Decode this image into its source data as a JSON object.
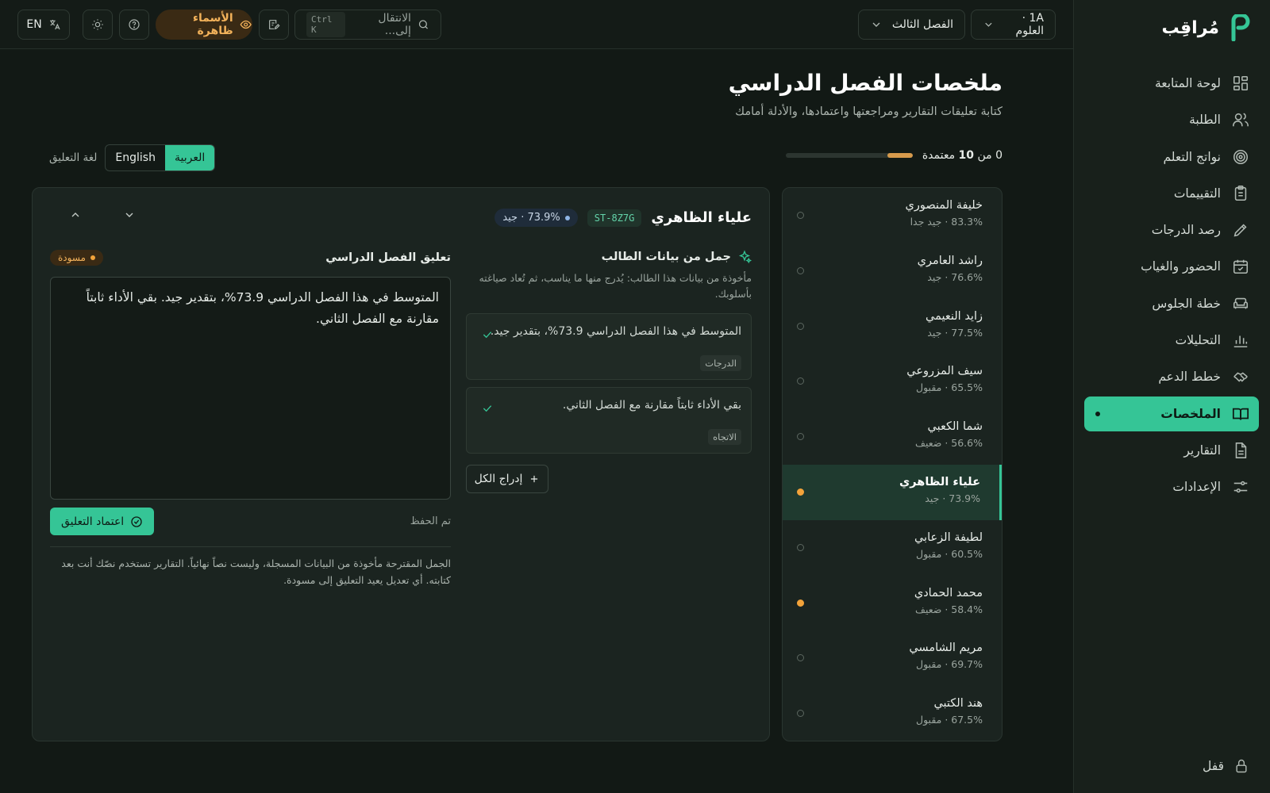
{
  "app": {
    "name": "مُراقِب"
  },
  "sidebar": {
    "items": [
      {
        "label": "لوحة المتابعة",
        "icon": "dashboard-icon"
      },
      {
        "label": "الطلبة",
        "icon": "users-icon"
      },
      {
        "label": "نواتج التعلم",
        "icon": "target-icon"
      },
      {
        "label": "التقييمات",
        "icon": "clipboard-icon"
      },
      {
        "label": "رصد الدرجات",
        "icon": "pencil-icon"
      },
      {
        "label": "الحضور والغياب",
        "icon": "calendar-check-icon"
      },
      {
        "label": "خطة الجلوس",
        "icon": "sofa-icon"
      },
      {
        "label": "التحليلات",
        "icon": "bar-chart-icon"
      },
      {
        "label": "خطط الدعم",
        "icon": "handshake-icon"
      },
      {
        "label": "الملخصات",
        "icon": "book-open-icon"
      },
      {
        "label": "التقارير",
        "icon": "file-text-icon"
      },
      {
        "label": "الإعدادات",
        "icon": "sliders-icon"
      }
    ],
    "active_index": 9,
    "lock_label": "قفل"
  },
  "topbar": {
    "class_select": "1A · العلوم",
    "term_select": "الفصل الثالث",
    "search_placeholder": "الانتقال إلى...",
    "search_shortcut": "Ctrl K",
    "names_toggle": "الأسماء ظاهرة",
    "lang_button": "EN"
  },
  "header": {
    "title": "ملخصات الفصل الدراسي",
    "subtitle": "كتابة تعليقات التقارير ومراجعتها واعتمادها، والأدلة أمامك",
    "progress": {
      "approved": 0,
      "total": 10,
      "text_a": "0 من ",
      "text_b": "10",
      "text_c": " معتمدة",
      "fill_fraction": 0.2
    }
  },
  "comment_language": {
    "label": "لغة التعليق",
    "options": [
      "العربية",
      "English"
    ],
    "selected": "العربية"
  },
  "students": [
    {
      "name": "خليفة المنصوري",
      "meta": "83.3% · جيد جدا",
      "status": "none"
    },
    {
      "name": "راشد العامري",
      "meta": "76.6% · جيد",
      "status": "none"
    },
    {
      "name": "زايد النعيمي",
      "meta": "77.5% · جيد",
      "status": "none"
    },
    {
      "name": "سيف المزروعي",
      "meta": "65.5% · مقبول",
      "status": "none"
    },
    {
      "name": "شما الكعبي",
      "meta": "56.6% · ضعيف",
      "status": "none"
    },
    {
      "name": "علياء الظاهري",
      "meta": "73.9% · جيد",
      "status": "draft",
      "active": true
    },
    {
      "name": "لطيفة الزعابي",
      "meta": "60.5% · مقبول",
      "status": "none"
    },
    {
      "name": "محمد الحمادي",
      "meta": "58.4% · ضعيف",
      "status": "draft"
    },
    {
      "name": "مريم الشامسي",
      "meta": "69.7% · مقبول",
      "status": "none"
    },
    {
      "name": "هند الكتبي",
      "meta": "67.5% · مقبول",
      "status": "none"
    }
  ],
  "editor": {
    "student_name": "علياء الظاهري",
    "student_id": "ST-8Z7G",
    "grade_badge": "73.9% · جيد",
    "suggestions": {
      "title": "جمل من بيانات الطالب",
      "subtitle": "مأخوذة من بيانات هذا الطالب: يُدرج منها ما يناسب، ثم تُعاد صياغته بأسلوبك.",
      "items": [
        {
          "text": "المتوسط في هذا الفصل الدراسي 73.9%، بتقدير جيد.",
          "tag": "الدرجات"
        },
        {
          "text": "بقي الأداء ثابتاً مقارنة مع الفصل الثاني.",
          "tag": "الاتجاه"
        }
      ],
      "insert_all": "إدراج الكل"
    },
    "comment": {
      "title": "تعليق الفصل الدراسي",
      "status": "مسودة",
      "text": "المتوسط في هذا الفصل الدراسي 73.9%، بتقدير جيد. بقي الأداء ثابتاً مقارنة مع الفصل الثاني.",
      "saved": "تم الحفظ",
      "approve": "اعتماد التعليق",
      "note": "الجمل المقترحة مأخوذة من البيانات المسجلة، وليست نصاً نهائياً. التقارير تستخدم نصّك أنت بعد كتابته. أي تعديل يعيد التعليق إلى مسودة."
    }
  },
  "colors": {
    "accent": "#35c596",
    "draft": "#f3a33a",
    "background": "#121915"
  }
}
